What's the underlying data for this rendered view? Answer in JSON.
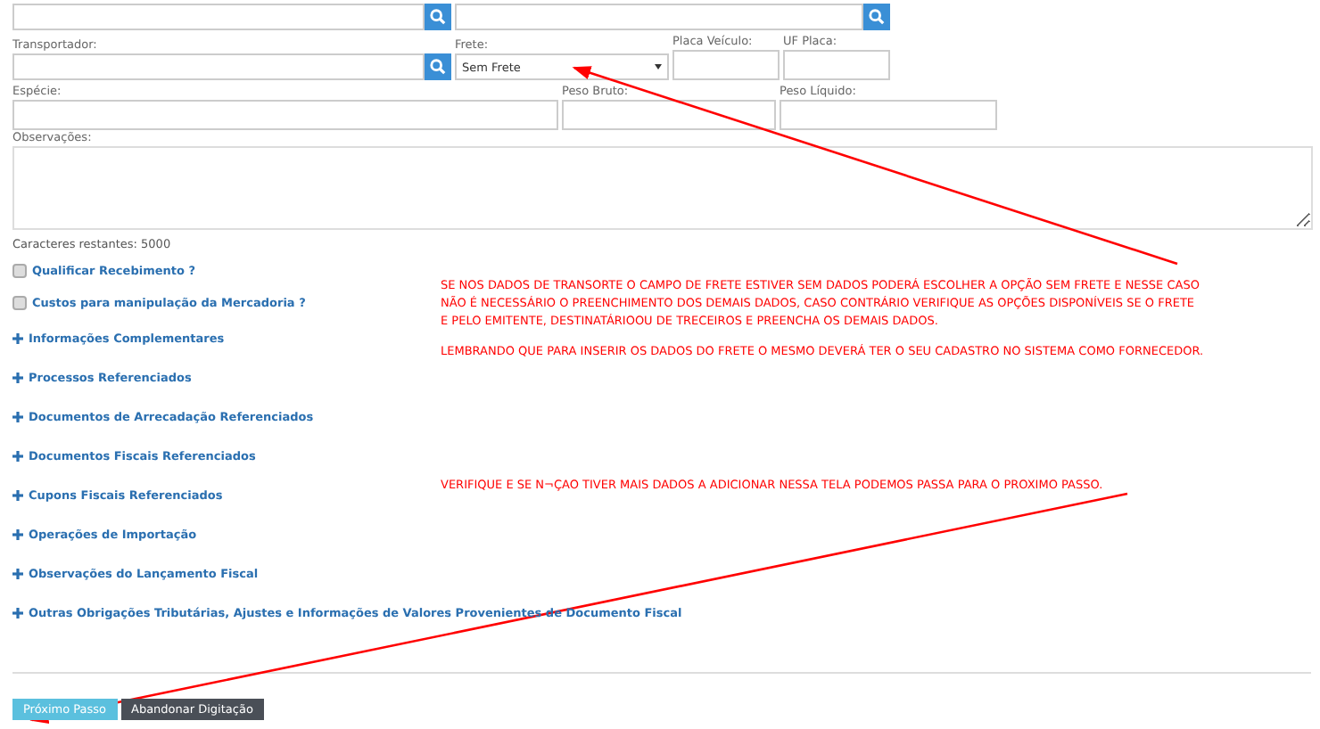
{
  "top_fields": [
    {
      "kind": "lookup"
    },
    {
      "kind": "lookup"
    }
  ],
  "transport_row": [
    {
      "kind": "lookup",
      "label": "Transportador:"
    },
    {
      "kind": "select",
      "label": "Frete:",
      "value": "Sem Frete"
    },
    {
      "kind": "text",
      "label": "Placa Veículo:"
    },
    {
      "kind": "text",
      "label": "UF Placa:"
    }
  ],
  "cargo_row": [
    {
      "kind": "text",
      "label": "Espécie:"
    },
    {
      "kind": "text",
      "label": "Peso Bruto:"
    },
    {
      "kind": "text",
      "label": "Peso Líquido:"
    }
  ],
  "notes": {
    "label": "Observações:",
    "counter": "Caracteres restantes: 5000"
  },
  "checkboxes": [
    {
      "label": "Qualificar Recebimento ?",
      "checked": false
    },
    {
      "label": "Custos para manipulação da Mercadoria ?",
      "checked": false
    }
  ],
  "sections": [
    {
      "label": "Informações Complementares",
      "expanded": false
    },
    {
      "label": "Processos Referenciados",
      "expanded": false
    },
    {
      "label": "Documentos de Arrecadação Referenciados",
      "expanded": false
    },
    {
      "label": "Documentos Fiscais Referenciados",
      "expanded": false
    },
    {
      "label": "Cupons Fiscais Referenciados",
      "expanded": false
    },
    {
      "label": "Operações de Importação",
      "expanded": false
    },
    {
      "label": "Observações do Lançamento Fiscal",
      "expanded": false
    },
    {
      "label": "Outras Obrigações Tributárias, Ajustes e Informações de Valores Provenientes de Documento Fiscal",
      "expanded": false
    }
  ],
  "annotations": [
    {
      "lines": [
        "SE NOS DADOS DE TRANSORTE O CAMPO DE FRETE ESTIVER SEM DADOS PODERÁ ESCOLHER A OPÇÃO SEM FRETE E NESSE CASO",
        "NÃO É NECESSÁRIO O PREENCHIMENTO DOS DEMAIS DADOS, CASO CONTRÁRIO VERIFIQUE AS OPÇÕES DISPONÍVEIS SE O FRETE",
        "E PELO EMITENTE, DESTINATÁRIOOU DE TRECEIROS E PREENCHA OS DEMAIS DADOS."
      ]
    },
    {
      "lines": [
        "LEMBRANDO QUE PARA INSERIR OS DADOS DO FRETE O MESMO DEVERÁ TER O SEU CADASTRO NO SISTEMA COMO FORNECEDOR."
      ]
    },
    {
      "lines": [
        "VERIFIQUE E SE N¬ÇAO TIVER MAIS DADOS A ADICIONAR NESSA TELA PODEMOS PASSA PARA O PROXIMO PASSO."
      ]
    }
  ],
  "buttons": [
    {
      "label": "Próximo Passo",
      "kind": "primary"
    },
    {
      "label": "Abandonar Digitação",
      "kind": "dark"
    }
  ]
}
